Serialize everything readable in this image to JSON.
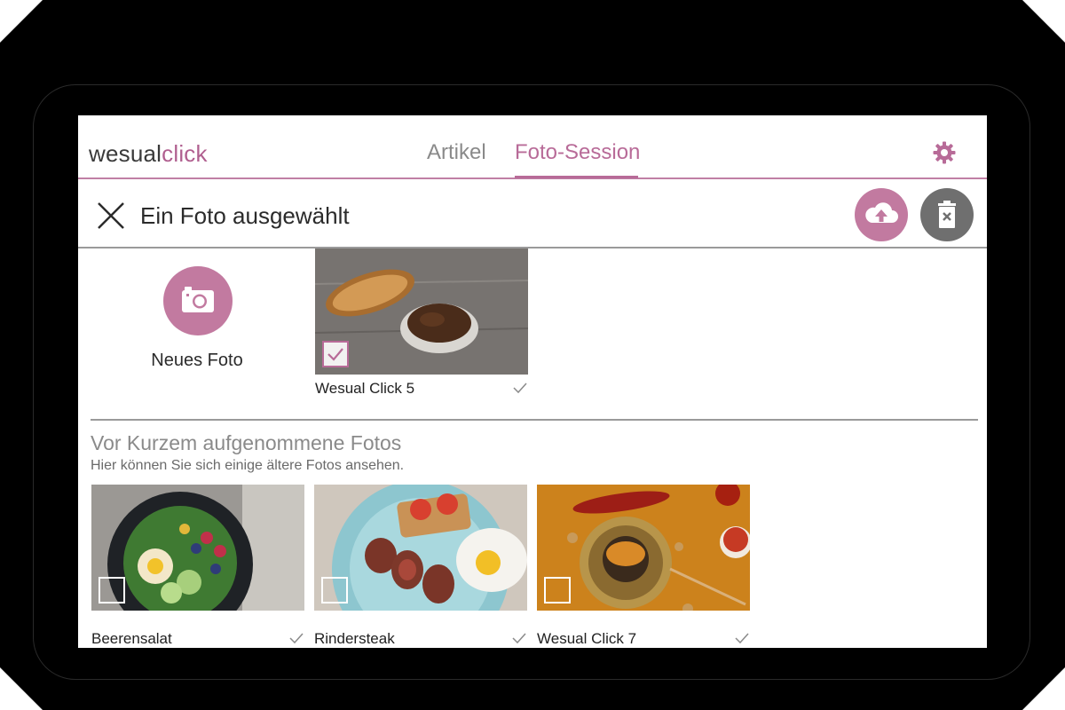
{
  "app": {
    "logo_part1": "wesual",
    "logo_part2": "click",
    "tabs": [
      {
        "label": "Artikel"
      },
      {
        "label": "Foto-Session"
      }
    ],
    "active_tab": "Foto-Session",
    "settings_icon": "gear-icon"
  },
  "selection_bar": {
    "title": "Ein Foto ausgewählt",
    "close_icon": "close-icon",
    "upload_icon": "cloud-upload-icon",
    "delete_icon": "trash-icon"
  },
  "new_photo": {
    "label": "Neues Foto",
    "icon": "camera-icon"
  },
  "session_photos": [
    {
      "label": "Wesual Click 5",
      "selected": true
    }
  ],
  "recent": {
    "title": "Vor Kurzem aufgenommene Fotos",
    "subtitle": "Hier können Sie sich einige ältere Fotos ansehen.",
    "photos": [
      {
        "label": "Beerensalat",
        "selected": false
      },
      {
        "label": "Rindersteak",
        "selected": false
      },
      {
        "label": "Wesual Click 7",
        "selected": false
      }
    ]
  },
  "colors": {
    "accent": "#b86b98",
    "accent_button": "#c27aa0",
    "delete_button": "#6f6f6f"
  }
}
